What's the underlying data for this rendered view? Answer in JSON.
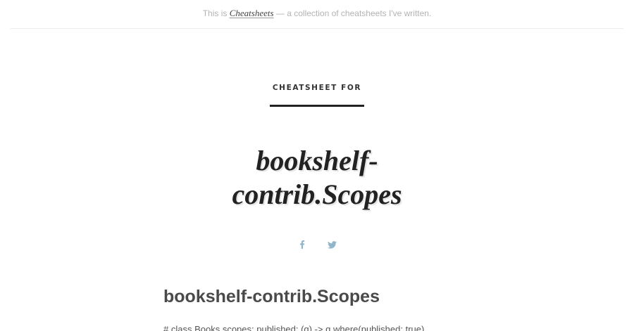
{
  "topbar": {
    "prefix": "This is",
    "link_label": "Cheatsheets",
    "suffix": "— a collection of cheatsheets I've written."
  },
  "hero": {
    "pre_title": "CHEATSHEET FOR",
    "title_line_1": "bookshelf-",
    "title_line_2": "contrib.Scopes"
  },
  "share": {
    "facebook_icon": "facebook-icon",
    "twitter_icon": "twitter-icon",
    "icon_color": "#8fb7c9"
  },
  "content": {
    "heading": "bookshelf-contrib.Scopes",
    "code_line": "# class Books scopes: published: (q) -> q.where(published: true)"
  }
}
